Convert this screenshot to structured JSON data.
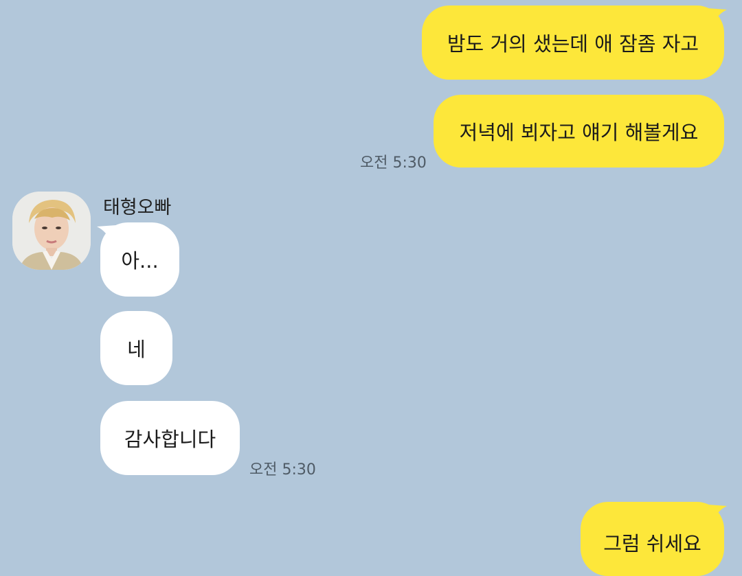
{
  "colors": {
    "background": "#b2c7da",
    "my_bubble": "#fde73a",
    "their_bubble": "#ffffff",
    "time_text": "#4f5b66"
  },
  "chat": {
    "outgoing_group_1": {
      "messages": [
        "밤도 거의 샜는데 애 잠좀 자고",
        "저녁에 뵈자고 얘기 해볼게요"
      ],
      "time": "오전 5:30"
    },
    "incoming_group": {
      "sender_name": "태형오빠",
      "avatar_icon": "profile-photo",
      "messages": [
        "아...",
        "네",
        "감사합니다"
      ],
      "time": "오전 5:30"
    },
    "outgoing_group_2": {
      "messages": [
        "그럼 쉬세요"
      ]
    }
  }
}
